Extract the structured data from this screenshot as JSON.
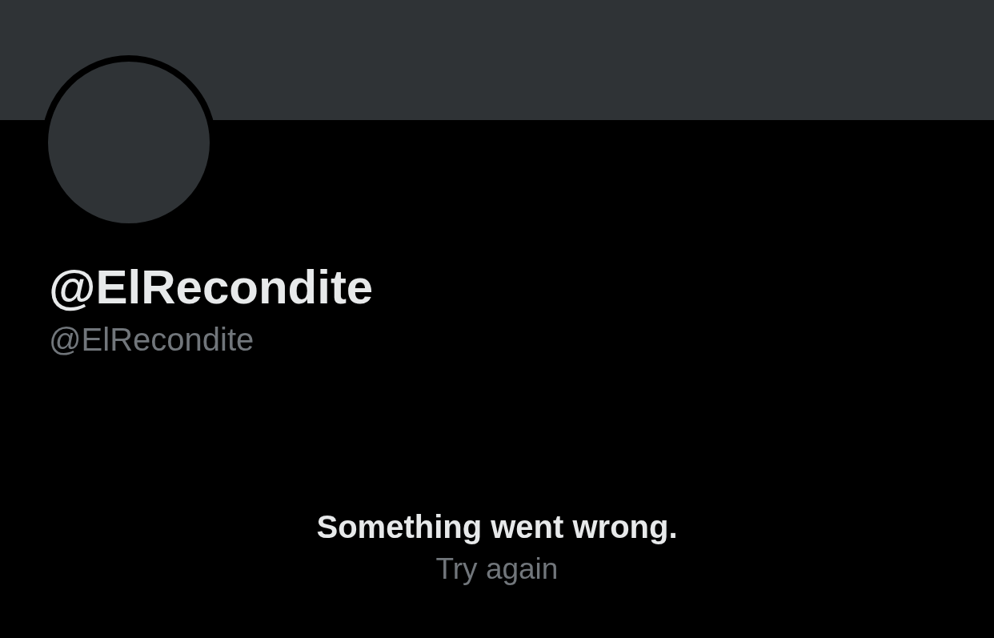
{
  "profile": {
    "display_name": "@ElRecondite",
    "handle": "@ElRecondite"
  },
  "error": {
    "message": "Something went wrong.",
    "retry": "Try again"
  }
}
